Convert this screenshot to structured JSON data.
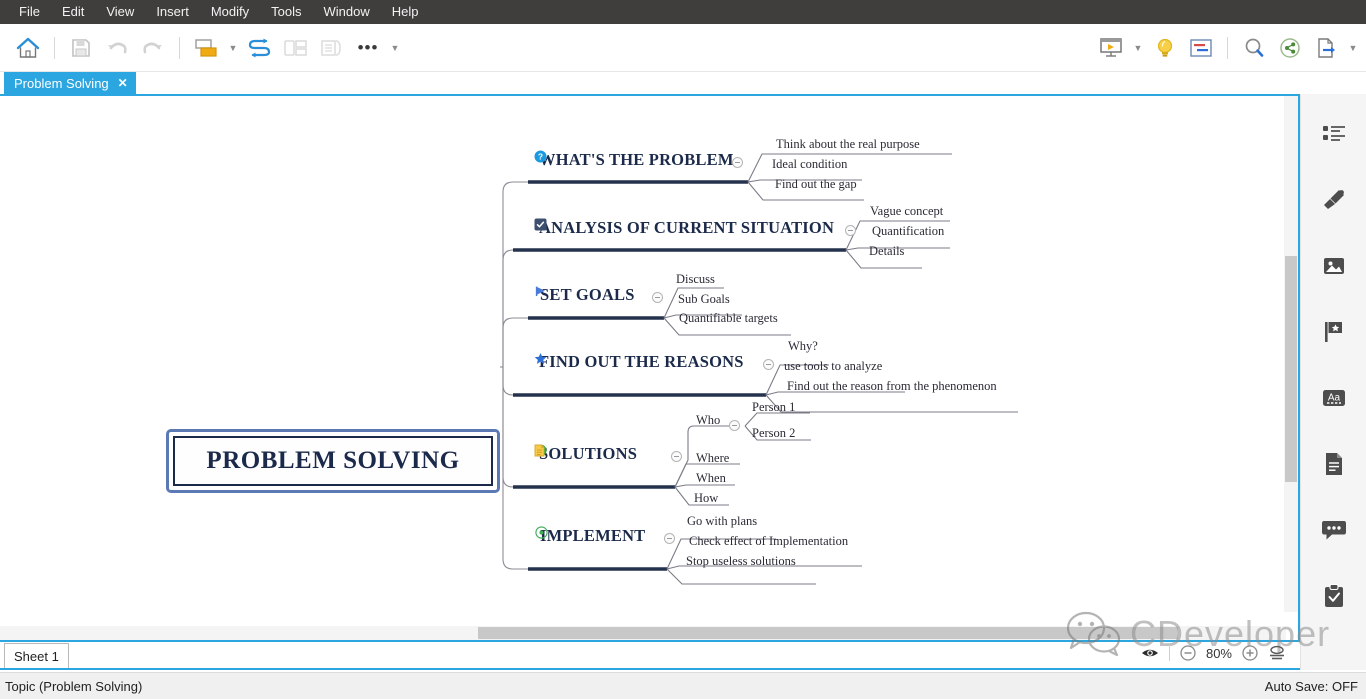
{
  "menu": {
    "items": [
      "File",
      "Edit",
      "View",
      "Insert",
      "Modify",
      "Tools",
      "Window",
      "Help"
    ]
  },
  "toolbar": {
    "left": [
      {
        "name": "home-icon",
        "label": "Home"
      },
      {
        "name": "save-icon",
        "label": "Save"
      },
      {
        "name": "undo-icon",
        "label": "Undo"
      },
      {
        "name": "redo-icon",
        "label": "Redo"
      },
      {
        "name": "topic-icon",
        "label": "Topic"
      },
      {
        "name": "relationship-icon",
        "label": "Relationship"
      },
      {
        "name": "boundary-icon",
        "label": "Boundary"
      },
      {
        "name": "summary-icon",
        "label": "Summary"
      },
      {
        "name": "more-icon",
        "label": "More"
      }
    ],
    "right": [
      {
        "name": "presentation-icon",
        "label": "Presentation"
      },
      {
        "name": "brainstorm-icon",
        "label": "Brainstorm"
      },
      {
        "name": "gantt-icon",
        "label": "Gantt"
      },
      {
        "name": "search-icon",
        "label": "Search"
      },
      {
        "name": "share-icon",
        "label": "Share"
      },
      {
        "name": "export-icon",
        "label": "Export"
      }
    ]
  },
  "tab": {
    "title": "Problem Solving",
    "close_label": "✕"
  },
  "sheet": {
    "label": "Sheet 1"
  },
  "zoom_controls": {
    "eye_label": "Focus",
    "minus_label": "−",
    "percent": "80%",
    "plus_label": "+",
    "fit_label": "Fit"
  },
  "watermark": {
    "text": "CDeveloper"
  },
  "statusbar": {
    "left": "Topic (Problem Solving)",
    "right": "Auto Save: OFF"
  },
  "sidebar": {
    "items": [
      {
        "name": "outline-icon",
        "label": "Outline"
      },
      {
        "name": "brush-icon",
        "label": "Style"
      },
      {
        "name": "image-icon",
        "label": "Image"
      },
      {
        "name": "flag-icon",
        "label": "Marker"
      },
      {
        "name": "font-icon",
        "label": "Aa"
      },
      {
        "name": "notes-icon",
        "label": "Notes"
      },
      {
        "name": "comment-icon",
        "label": "Comment"
      },
      {
        "name": "task-icon",
        "label": "Task"
      }
    ]
  },
  "colors": {
    "accent": "#2ba6e0",
    "menu_bg": "#403e3c",
    "node_text": "#1b2a4a",
    "branch_line": "#2a3550",
    "selection": "#5b79b5"
  },
  "mindmap": {
    "central": {
      "text": "PROBLEM SOLVING"
    },
    "branches": [
      {
        "id": "whats-the-problem",
        "label": "WHAT'S THE PROBLEM",
        "icon": "question-mark-icon",
        "note": null,
        "children": [
          {
            "label": "Think about the real purpose"
          },
          {
            "label": "Ideal condition"
          },
          {
            "label": "Find out the gap"
          }
        ]
      },
      {
        "id": "analysis-of-current-situation",
        "label": "ANALYSIS OF CURRENT SITUATION",
        "icon": "checkbox-square-icon",
        "note": null,
        "children": [
          {
            "label": "Vague concept"
          },
          {
            "label": "Quantification"
          },
          {
            "label": "Details"
          }
        ]
      },
      {
        "id": "set-goals",
        "label": "SET GOALS",
        "icon": "triangle-flag-icon",
        "note": null,
        "children": [
          {
            "label": "Discuss"
          },
          {
            "label": "Sub Goals"
          },
          {
            "label": "Quantifiable targets"
          }
        ]
      },
      {
        "id": "find-out-the-reasons",
        "label": "FIND OUT THE REASONS",
        "icon": "star-icon",
        "note": null,
        "children": [
          {
            "label": "Why?"
          },
          {
            "label": "use tools to analyze"
          },
          {
            "label": "Find out the reason from the phenomenon"
          }
        ]
      },
      {
        "id": "solutions",
        "label": "SOLUTIONS",
        "icon": "green-check-icon",
        "note": "note-icon",
        "children": [
          {
            "label": "Who",
            "children": [
              {
                "label": "Person 1"
              },
              {
                "label": "Person 2"
              }
            ]
          },
          {
            "label": "Where"
          },
          {
            "label": "When"
          },
          {
            "label": "How"
          }
        ]
      },
      {
        "id": "implement",
        "label": "IMPLEMENT",
        "icon": "target-circle-icon",
        "note": null,
        "children": [
          {
            "label": "Go with plans"
          },
          {
            "label": "Check effect of Implementation"
          },
          {
            "label": "Stop useless solutions"
          }
        ]
      }
    ]
  }
}
